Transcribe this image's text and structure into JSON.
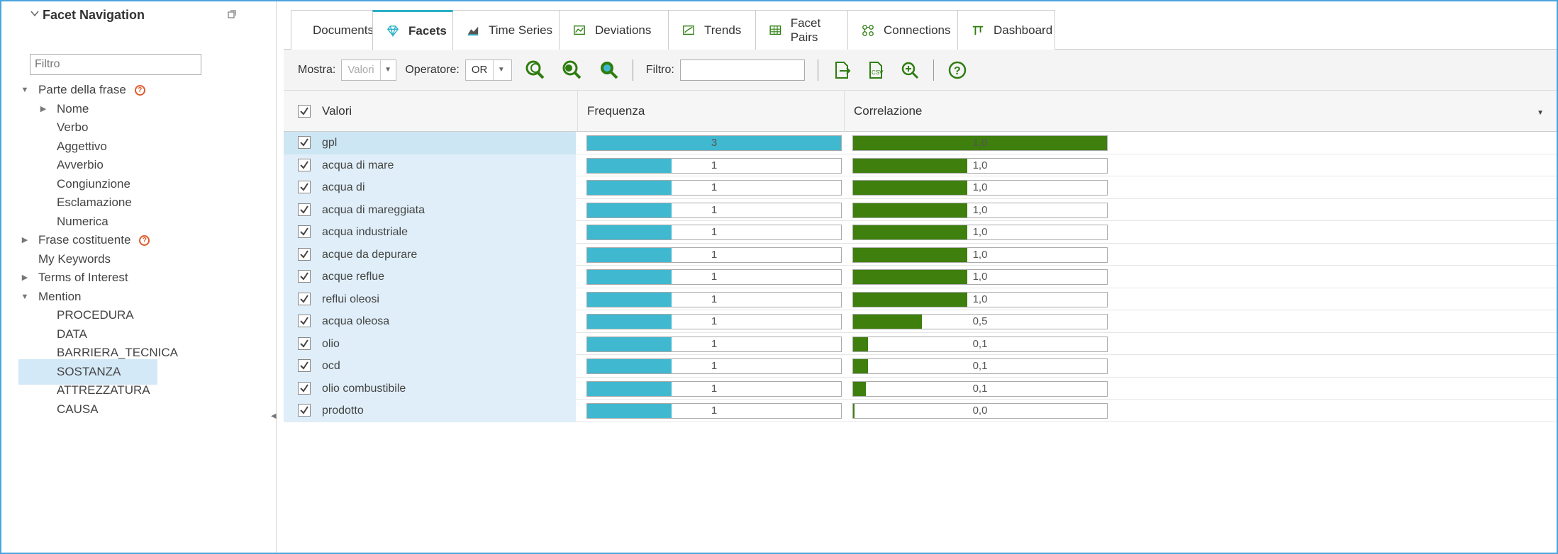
{
  "sidebar": {
    "title": "Facet Navigation",
    "filter_placeholder": "Filtro",
    "items": [
      {
        "label": "Parte della frase",
        "level": 0,
        "expander": "expanded",
        "help": true
      },
      {
        "label": "Nome",
        "level": 1,
        "expander": "collapsed"
      },
      {
        "label": "Verbo",
        "level": 1
      },
      {
        "label": "Aggettivo",
        "level": 1
      },
      {
        "label": "Avverbio",
        "level": 1
      },
      {
        "label": "Congiunzione",
        "level": 1
      },
      {
        "label": "Esclamazione",
        "level": 1
      },
      {
        "label": "Numerica",
        "level": 1
      },
      {
        "label": "Frase costituente",
        "level": 0,
        "expander": "collapsed",
        "help": true
      },
      {
        "label": "My Keywords",
        "level": 0
      },
      {
        "label": "Terms of Interest",
        "level": 0,
        "expander": "collapsed"
      },
      {
        "label": "Mention",
        "level": 0,
        "expander": "expanded"
      },
      {
        "label": "PROCEDURA",
        "level": 1
      },
      {
        "label": "DATA",
        "level": 1
      },
      {
        "label": "BARRIERA_TECNICA",
        "level": 1
      },
      {
        "label": "SOSTANZA",
        "level": 1,
        "selected": true
      },
      {
        "label": "ATTREZZATURA",
        "level": 1
      },
      {
        "label": "CAUSA",
        "level": 1
      }
    ]
  },
  "tabs": [
    {
      "label": "Documents",
      "icon": "document-icon"
    },
    {
      "label": "Facets",
      "icon": "gem-icon",
      "active": true
    },
    {
      "label": "Time Series",
      "icon": "area-chart-icon"
    },
    {
      "label": "Deviations",
      "icon": "line-chart-icon"
    },
    {
      "label": "Trends",
      "icon": "trend-chart-icon"
    },
    {
      "label": "Facet Pairs",
      "icon": "table-grid-icon"
    },
    {
      "label": "Connections",
      "icon": "connections-icon"
    },
    {
      "label": "Dashboard",
      "icon": "dashboard-icon"
    }
  ],
  "toolbar": {
    "show_label": "Mostra:",
    "show_value": "Valori",
    "operator_label": "Operatore:",
    "operator_value": "OR",
    "filter_label": "Filtro:",
    "filter_value": ""
  },
  "grid": {
    "headers": {
      "values": "Valori",
      "frequency": "Frequenza",
      "correlation": "Correlazione"
    },
    "rows": [
      {
        "label": "gpl",
        "frequency": 3,
        "frequency_text": "3",
        "frequency_fill": 1.0,
        "correlation_text": "1,0",
        "correlation_fill": 1.0
      },
      {
        "label": "acqua di mare",
        "frequency": 1,
        "frequency_text": "1",
        "frequency_fill": 0.333,
        "correlation_text": "1,0",
        "correlation_fill": 0.45
      },
      {
        "label": "acqua di",
        "frequency": 1,
        "frequency_text": "1",
        "frequency_fill": 0.333,
        "correlation_text": "1,0",
        "correlation_fill": 0.45
      },
      {
        "label": "acqua di mareggiata",
        "frequency": 1,
        "frequency_text": "1",
        "frequency_fill": 0.333,
        "correlation_text": "1,0",
        "correlation_fill": 0.45
      },
      {
        "label": "acqua industriale",
        "frequency": 1,
        "frequency_text": "1",
        "frequency_fill": 0.333,
        "correlation_text": "1,0",
        "correlation_fill": 0.45
      },
      {
        "label": "acque da depurare",
        "frequency": 1,
        "frequency_text": "1",
        "frequency_fill": 0.333,
        "correlation_text": "1,0",
        "correlation_fill": 0.45
      },
      {
        "label": "acque reflue",
        "frequency": 1,
        "frequency_text": "1",
        "frequency_fill": 0.333,
        "correlation_text": "1,0",
        "correlation_fill": 0.45
      },
      {
        "label": "reflui oleosi",
        "frequency": 1,
        "frequency_text": "1",
        "frequency_fill": 0.333,
        "correlation_text": "1,0",
        "correlation_fill": 0.45
      },
      {
        "label": "acqua oleosa",
        "frequency": 1,
        "frequency_text": "1",
        "frequency_fill": 0.333,
        "correlation_text": "0,5",
        "correlation_fill": 0.27
      },
      {
        "label": "olio",
        "frequency": 1,
        "frequency_text": "1",
        "frequency_fill": 0.333,
        "correlation_text": "0,1",
        "correlation_fill": 0.06
      },
      {
        "label": "ocd",
        "frequency": 1,
        "frequency_text": "1",
        "frequency_fill": 0.333,
        "correlation_text": "0,1",
        "correlation_fill": 0.06
      },
      {
        "label": "olio combustibile",
        "frequency": 1,
        "frequency_text": "1",
        "frequency_fill": 0.333,
        "correlation_text": "0,1",
        "correlation_fill": 0.05
      },
      {
        "label": "prodotto",
        "frequency": 1,
        "frequency_text": "1",
        "frequency_fill": 0.333,
        "correlation_text": "0,0",
        "correlation_fill": 0.005
      }
    ]
  },
  "colors": {
    "accent": "#2ab0c5",
    "frequency_bar": "#3fb8d0",
    "correlation_bar": "#3e7f0e",
    "selected_row": "#d4e9f7",
    "help_icon": "#e05a2b"
  }
}
